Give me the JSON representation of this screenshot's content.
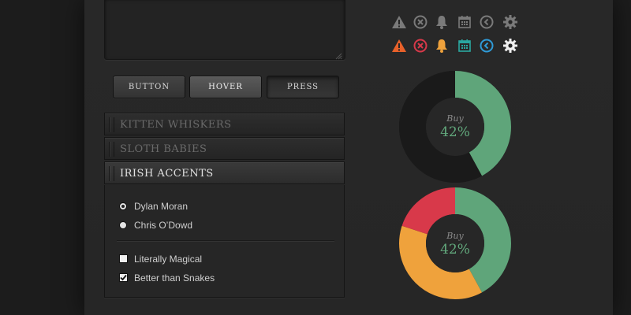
{
  "buttons": {
    "normal": "BUTTON",
    "hover": "HOVER",
    "press": "PRESS"
  },
  "accordion": {
    "sections": [
      {
        "label": "KITTEN WHISKERS",
        "expanded": false
      },
      {
        "label": "SLOTH BABIES",
        "expanded": false
      },
      {
        "label": "IRISH ACCENTS",
        "expanded": true
      }
    ],
    "radios": [
      {
        "label": "Dylan Moran",
        "checked": true
      },
      {
        "label": "Chris O’Dowd",
        "checked": false
      }
    ],
    "checkboxes": [
      {
        "label": "Literally Magical",
        "checked": false
      },
      {
        "label": "Better than Snakes",
        "checked": true
      }
    ]
  },
  "icons": {
    "row_muted": [
      "warning-icon",
      "close-circle-icon",
      "bell-icon",
      "calendar-icon",
      "back-arrow-icon",
      "gear-icon"
    ],
    "row_color": [
      "warning-icon",
      "close-circle-icon",
      "bell-icon",
      "calendar-icon",
      "back-arrow-icon",
      "gear-icon"
    ]
  },
  "colors": {
    "green": "#5fa57a",
    "red": "#d8394a",
    "orange": "#efa23c",
    "teal": "#2aa7a0",
    "blue": "#2f9bd8",
    "muted_icon": "#7a7a7a"
  },
  "donut_top": {
    "label": "Buy",
    "value_text": "42%",
    "segments": [
      {
        "name": "buy",
        "percent": 42,
        "color": "#5fa57a"
      },
      {
        "name": "remaining",
        "percent": 58,
        "color": "#1a1a1a"
      }
    ]
  },
  "donut_bottom": {
    "label": "Buy",
    "value_text": "42%",
    "segments": [
      {
        "name": "green",
        "percent": 42,
        "color": "#5fa57a"
      },
      {
        "name": "orange",
        "percent": 38,
        "color": "#efa23c"
      },
      {
        "name": "red",
        "percent": 20,
        "color": "#d8394a"
      }
    ]
  }
}
